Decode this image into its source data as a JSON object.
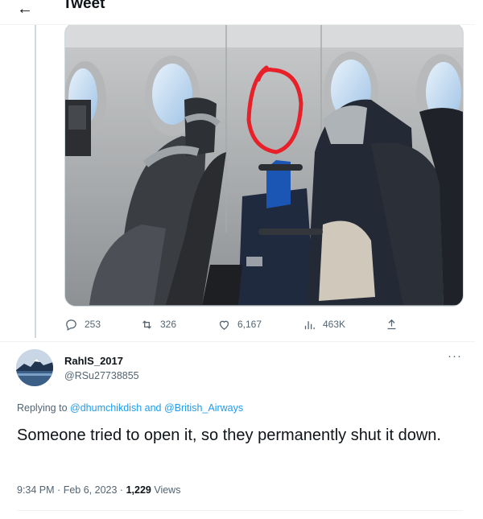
{
  "header": {
    "title": "Tweet",
    "back_glyph": "←"
  },
  "main_tweet": {
    "media_icon": "airplane-cabin-photo",
    "stats": {
      "replies": "253",
      "retweets": "326",
      "likes": "6,167",
      "views": "463K"
    }
  },
  "reply": {
    "display_name": "RahlS_2017",
    "handle": "@RSu27738855",
    "more_glyph": "···",
    "replying_prefix": "Replying to",
    "replying_to_1": "@dhumchikdish",
    "replying_and": "and",
    "replying_to_2": "@British_Airways",
    "text": "Someone tried to open it, so they permanently shut it down.",
    "time": "9:34 PM",
    "date": "Feb 6, 2023",
    "views_count": "1,229",
    "views_label": "Views"
  },
  "colors": {
    "accent": "#1d9bf0",
    "text": "#0f1419",
    "secondary": "#536471",
    "circle": "#e8202a"
  }
}
